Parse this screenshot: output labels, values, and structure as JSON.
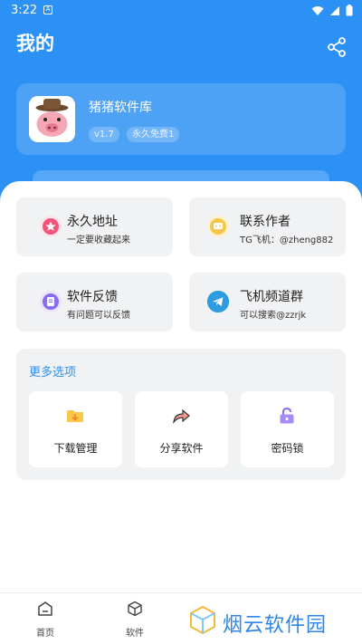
{
  "status_bar": {
    "time": "3:22",
    "notification": "A"
  },
  "header": {
    "title": "我的"
  },
  "app_info": {
    "name": "猪猪软件库",
    "version": "v1.7",
    "badge": "永久免费1"
  },
  "tiles": [
    {
      "title": "永久地址",
      "subtitle": "一定要收藏起来",
      "icon": "star-icon",
      "color": "#f2547a"
    },
    {
      "title": "联系作者",
      "subtitle": "TG飞机：@zheng882",
      "icon": "chat-icon",
      "color": "#f6c64a"
    },
    {
      "title": "软件反馈",
      "subtitle": "有问题可以反馈",
      "icon": "feedback-icon",
      "color": "#8a6cf0"
    },
    {
      "title": "飞机频道群",
      "subtitle": "可以搜索@zzrjk",
      "icon": "telegram-icon",
      "color": "#2f9be0"
    }
  ],
  "more": {
    "title": "更多选项",
    "options": [
      {
        "label": "下载管理",
        "icon": "download-folder-icon"
      },
      {
        "label": "分享软件",
        "icon": "share-arrow-icon"
      },
      {
        "label": "密码锁",
        "icon": "lock-icon"
      }
    ]
  },
  "tabbar": {
    "items": [
      {
        "label": "首页"
      },
      {
        "label": "软件"
      }
    ]
  },
  "watermark": {
    "text": "烟云软件园"
  },
  "colors": {
    "primary": "#2c91f5",
    "accent": "#2d8ff0"
  }
}
